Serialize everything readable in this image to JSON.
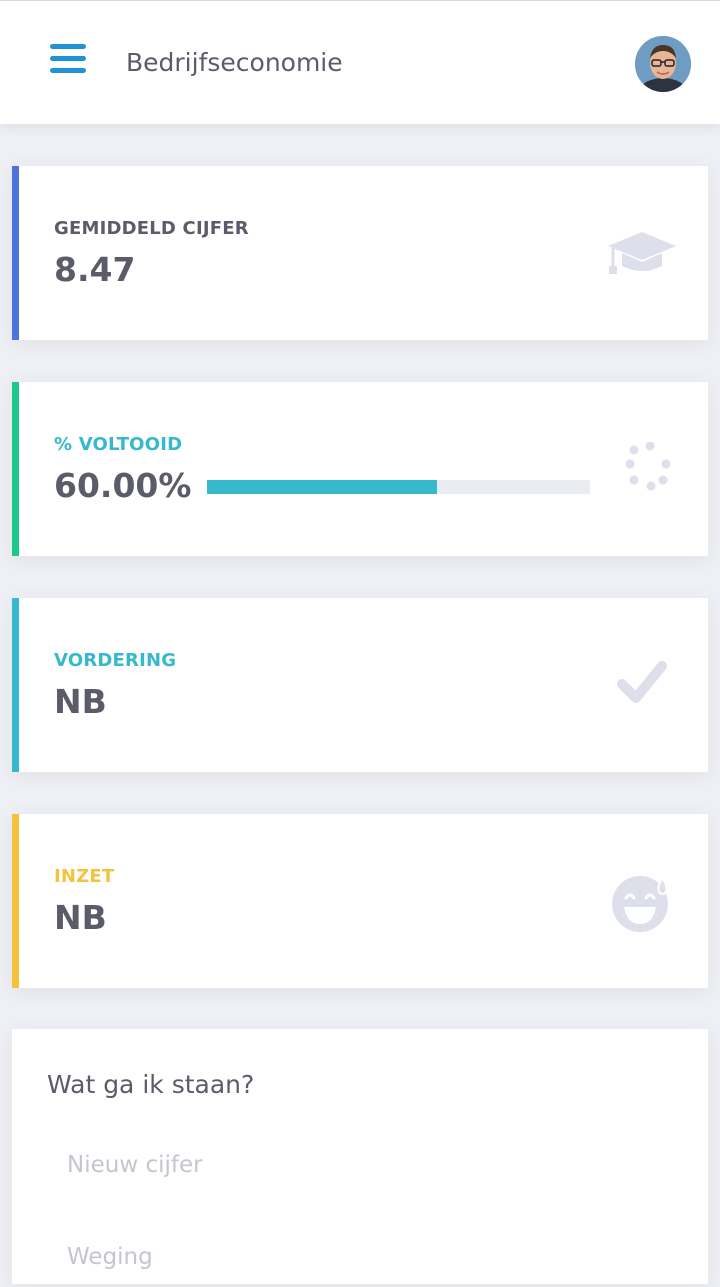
{
  "header": {
    "title": "Bedrijfseconomie"
  },
  "cards": {
    "average": {
      "label": "GEMIDDELD CIJFER",
      "value": "8.47",
      "accent": "#4e73df",
      "label_color": "#5a5c69",
      "icon": "graduation-cap-icon"
    },
    "completed": {
      "label": "% VOLTOOID",
      "value": "60.00%",
      "progress": 0.6,
      "accent": "#1cc88a",
      "label_color": "#36b9cc",
      "icon": "spinner-icon"
    },
    "progress": {
      "label": "VORDERING",
      "value": "NB",
      "accent": "#36b9cc",
      "label_color": "#36b9cc",
      "icon": "check-icon"
    },
    "effort": {
      "label": "INZET",
      "value": "NB",
      "accent": "#f6c23e",
      "label_color": "#f6c23e",
      "icon": "grin-sweat-icon"
    }
  },
  "calculator": {
    "title": "Wat ga ik staan?",
    "new_grade_placeholder": "Nieuw cijfer",
    "weight_placeholder": "Weging"
  }
}
